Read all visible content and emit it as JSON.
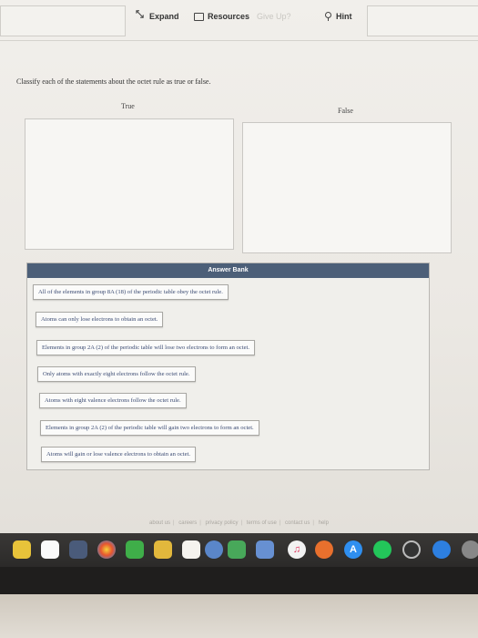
{
  "toolbar": {
    "expand_label": "Expand",
    "resources_label": "Resources",
    "give_up_label": "Give Up?",
    "hint_label": "Hint"
  },
  "question": {
    "prompt": "Classify each of the statements about the octet rule as true or false.",
    "true_label": "True",
    "false_label": "False"
  },
  "answer_bank": {
    "title": "Answer Bank",
    "items": [
      "All of the elements in group 8A (18) of the periodic table obey the octet rule.",
      "Atoms can only lose electrons to obtain an octet.",
      "Elements in group 2A (2) of the periodic table will lose two electrons to form an octet.",
      "Only atoms with exactly eight electrons follow the octet rule.",
      "Atoms with eight valence electrons follow the octet rule.",
      "Elements in group 2A (2) of the periodic table will gain two electrons to form an octet.",
      "Atoms will gain or lose valence electrons to obtain an octet."
    ]
  },
  "footer": {
    "links": [
      "about us",
      "careers",
      "privacy policy",
      "terms of use",
      "contact us",
      "help"
    ]
  },
  "dock": {
    "icons": [
      "finder-icon",
      "calendar-icon",
      "photos-icon",
      "facetime-icon",
      "notes-icon",
      "messages-icon",
      "numbers-icon",
      "keynote-icon",
      "music-icon",
      "books-icon",
      "app-store-icon",
      "spotify-icon",
      "time-machine-icon",
      "safari-icon"
    ]
  },
  "colors": {
    "bank_header": "#4c5f78",
    "item_text": "#3a4a72"
  }
}
